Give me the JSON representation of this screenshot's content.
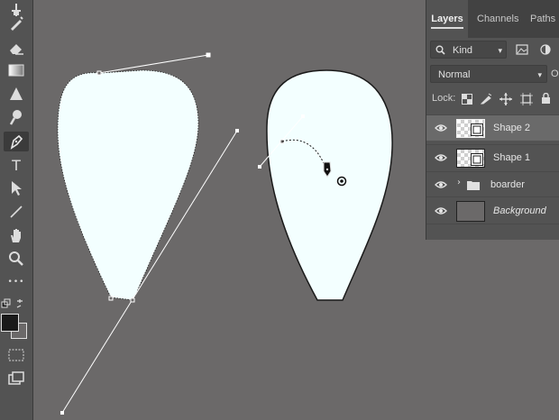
{
  "tools": [
    {
      "name": "move-tool-icon"
    },
    {
      "name": "brush-tool-icon"
    },
    {
      "name": "eraser-tool-icon"
    },
    {
      "name": "gradient-tool-icon"
    },
    {
      "name": "sharpen-tool-icon"
    },
    {
      "name": "dodge-tool-icon"
    },
    {
      "name": "pen-tool-icon",
      "active": true
    },
    {
      "name": "type-tool-icon",
      "glyph": "T"
    },
    {
      "name": "path-selection-tool-icon"
    },
    {
      "name": "line-tool-icon"
    },
    {
      "name": "hand-tool-icon"
    },
    {
      "name": "zoom-tool-icon"
    },
    {
      "name": "more-tools-icon",
      "glyph": "•••"
    }
  ],
  "colors": {
    "foreground": "#1a1a1a",
    "background": "#6b6969",
    "canvas": "#6b6969",
    "shape_fill": "#f3ffff"
  },
  "panel": {
    "tabs": [
      "Layers",
      "Channels",
      "Paths"
    ],
    "active_tab": "Layers",
    "filter_label": "Kind",
    "blend_mode": "Normal",
    "opacity_label": "Op",
    "lock_label": "Lock:",
    "layers": [
      {
        "name": "Shape 2",
        "type": "shape",
        "visible": true,
        "selected": true
      },
      {
        "name": "Shape 1",
        "type": "shape",
        "visible": true,
        "selected": false
      },
      {
        "name": "boarder",
        "type": "group",
        "visible": true,
        "selected": false
      },
      {
        "name": "Background",
        "type": "background",
        "visible": true,
        "selected": false,
        "italic": true
      }
    ]
  }
}
